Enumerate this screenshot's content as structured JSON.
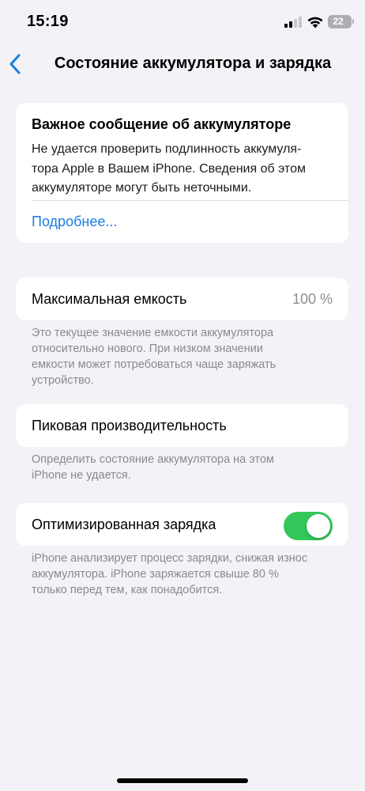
{
  "status_bar": {
    "time": "15:19",
    "battery_level": "22",
    "icons": [
      "cellular-signal-icon",
      "wifi-icon",
      "battery-icon"
    ]
  },
  "nav": {
    "back_icon": "chevron-left-icon",
    "title": "Состояние аккумулятора и зарядка"
  },
  "warning": {
    "title": "Важное сообщение об аккумуляторе",
    "lines": [
      "Не удается проверить подлинность аккумуля-",
      "тора Apple в Вашем iPhone. Сведения об этом",
      "аккумуляторе могут быть неточными."
    ],
    "link": "Подробнее..."
  },
  "max_capacity": {
    "label": "Максимальная емкость",
    "value": "100 %",
    "footnote_lines": [
      "Это текущее значение емкости аккумулятора",
      "относительно нового. При низком значении",
      "емкости может потребоваться чаще заряжать",
      "устройство."
    ]
  },
  "peak_performance": {
    "label": "Пиковая производительность",
    "footnote_lines": [
      "Определить состояние аккумулятора на этом",
      "iPhone не удается."
    ]
  },
  "optimized_charging": {
    "label": "Оптимизированная зарядка",
    "enabled": true,
    "footnote_lines": [
      "iPhone анализирует процесс зарядки, снижая износ",
      "аккумулятора. iPhone заряжается свыше 80 %",
      "только перед тем, как понадобится."
    ]
  },
  "colors": {
    "background": "#f2f2f7",
    "card": "#ffffff",
    "link": "#1a7ee0",
    "toggle_on": "#34c759",
    "secondary_text": "#8e8e93"
  }
}
